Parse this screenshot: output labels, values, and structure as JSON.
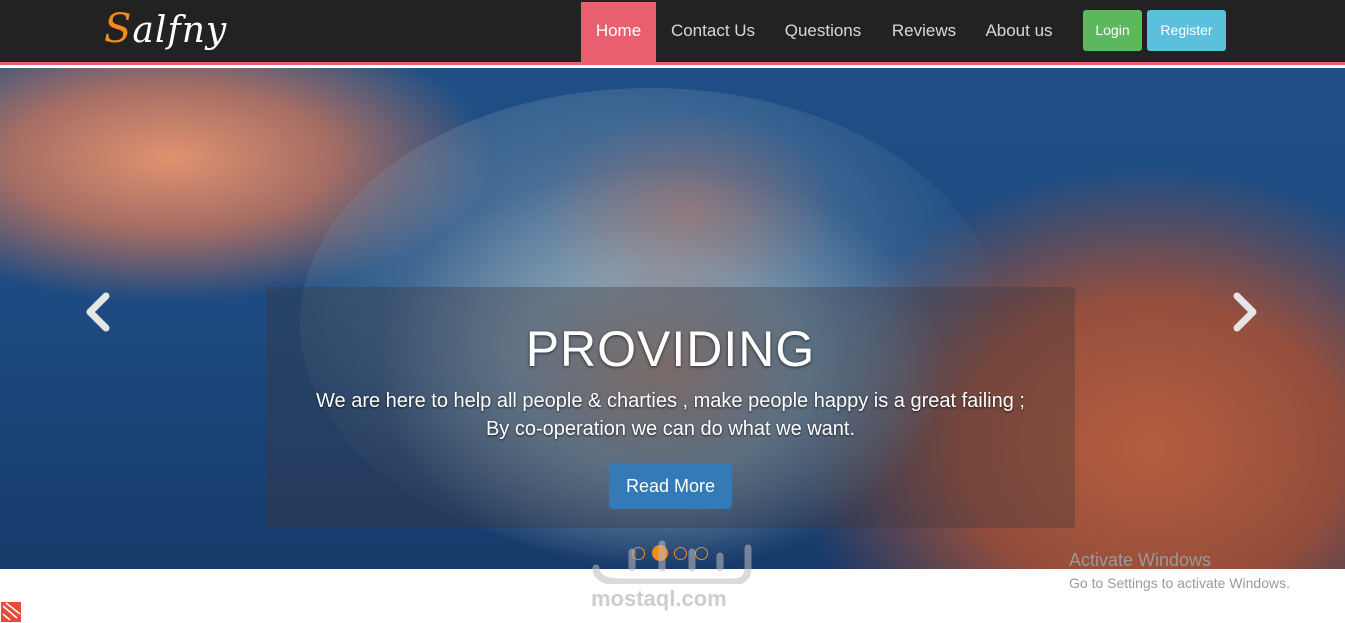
{
  "brand": {
    "logo_first": "S",
    "logo_rest": "alfny"
  },
  "nav": {
    "items": [
      {
        "label": "Home",
        "active": true
      },
      {
        "label": "Contact Us",
        "active": false
      },
      {
        "label": "Questions",
        "active": false
      },
      {
        "label": "Reviews",
        "active": false
      },
      {
        "label": "About us",
        "active": false
      }
    ],
    "login_label": "Login",
    "register_label": "Register"
  },
  "hero": {
    "title": "PROVIDING",
    "line1": "We are here to help all people & charties , make people happy is a great failing ;",
    "line2": "By co-operation we can do what we want.",
    "button_label": "Read More",
    "slide_count": 4,
    "active_slide": 1,
    "prev_icon": "chevron-left-icon",
    "next_icon": "chevron-right-icon"
  },
  "system": {
    "activate_title": "Activate Windows",
    "activate_sub": "Go to Settings to activate Windows."
  },
  "watermark": {
    "text": "mostaql.com"
  },
  "colors": {
    "navbar_bg": "#222222",
    "accent": "#e8606f",
    "login": "#5cb85c",
    "register": "#5bc0de",
    "primary_button": "#337ab7",
    "indicator": "#f28a1e"
  }
}
